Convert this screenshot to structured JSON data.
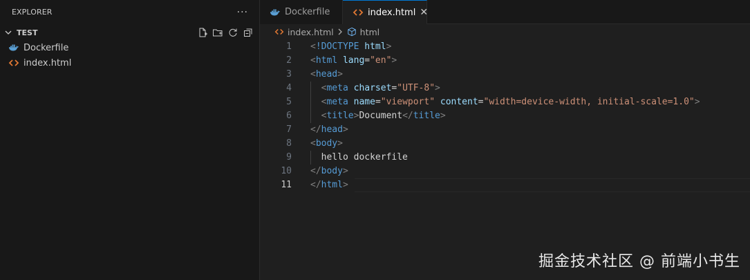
{
  "colors": {
    "accent": "#0078d4",
    "html_icon": "#e37933",
    "docker_icon": "#5a9fd4",
    "tag": "#569cd6",
    "attr": "#9cdcfe",
    "string": "#ce9178"
  },
  "sidebar": {
    "title": "EXPLORER",
    "more": "···",
    "folder": "TEST",
    "files": [
      {
        "name": "Dockerfile",
        "icon": "docker-icon"
      },
      {
        "name": "index.html",
        "icon": "html-file-icon"
      }
    ],
    "actions": [
      "new-file-icon",
      "new-folder-icon",
      "refresh-icon",
      "collapse-all-icon"
    ]
  },
  "tabs": [
    {
      "label": "Dockerfile",
      "active": false
    },
    {
      "label": "index.html",
      "active": true
    }
  ],
  "breadcrumb": {
    "file": "index.html",
    "element": "html"
  },
  "editor": {
    "current_line": 11,
    "lines": [
      {
        "num": "1",
        "tokens": [
          [
            "punc",
            "<"
          ],
          [
            "tag",
            "!DOCTYPE"
          ],
          [
            "punc",
            " "
          ],
          [
            "attr",
            "html"
          ],
          [
            "punc",
            ">"
          ]
        ]
      },
      {
        "num": "2",
        "tokens": [
          [
            "punc",
            "<"
          ],
          [
            "tag",
            "html"
          ],
          [
            "punc",
            " "
          ],
          [
            "attr",
            "lang"
          ],
          [
            "text",
            "="
          ],
          [
            "str",
            "\"en\""
          ],
          [
            "punc",
            ">"
          ]
        ]
      },
      {
        "num": "3",
        "tokens": [
          [
            "punc",
            "<"
          ],
          [
            "tag",
            "head"
          ],
          [
            "punc",
            ">"
          ]
        ]
      },
      {
        "num": "4",
        "tokens": [
          [
            "text",
            "  "
          ],
          [
            "punc",
            "<"
          ],
          [
            "tag",
            "meta"
          ],
          [
            "punc",
            " "
          ],
          [
            "attr",
            "charset"
          ],
          [
            "text",
            "="
          ],
          [
            "str",
            "\"UTF-8\""
          ],
          [
            "punc",
            ">"
          ]
        ]
      },
      {
        "num": "5",
        "tokens": [
          [
            "text",
            "  "
          ],
          [
            "punc",
            "<"
          ],
          [
            "tag",
            "meta"
          ],
          [
            "punc",
            " "
          ],
          [
            "attr",
            "name"
          ],
          [
            "text",
            "="
          ],
          [
            "str",
            "\"viewport\""
          ],
          [
            "punc",
            " "
          ],
          [
            "attr",
            "content"
          ],
          [
            "text",
            "="
          ],
          [
            "str",
            "\"width=device-width, initial-scale=1.0\""
          ],
          [
            "punc",
            ">"
          ]
        ]
      },
      {
        "num": "6",
        "tokens": [
          [
            "text",
            "  "
          ],
          [
            "punc",
            "<"
          ],
          [
            "tag",
            "title"
          ],
          [
            "punc",
            ">"
          ],
          [
            "text",
            "Document"
          ],
          [
            "punc",
            "</"
          ],
          [
            "tag",
            "title"
          ],
          [
            "punc",
            ">"
          ]
        ]
      },
      {
        "num": "7",
        "tokens": [
          [
            "punc",
            "</"
          ],
          [
            "tag",
            "head"
          ],
          [
            "punc",
            ">"
          ]
        ]
      },
      {
        "num": "8",
        "tokens": [
          [
            "punc",
            "<"
          ],
          [
            "tag",
            "body"
          ],
          [
            "punc",
            ">"
          ]
        ]
      },
      {
        "num": "9",
        "tokens": [
          [
            "text",
            "  hello dockerfile"
          ]
        ]
      },
      {
        "num": "10",
        "tokens": [
          [
            "punc",
            "</"
          ],
          [
            "tag",
            "body"
          ],
          [
            "punc",
            ">"
          ]
        ]
      },
      {
        "num": "11",
        "tokens": [
          [
            "punc",
            "</"
          ],
          [
            "tag",
            "html"
          ],
          [
            "punc",
            ">"
          ]
        ]
      }
    ]
  },
  "watermark": "掘金技术社区 @ 前端小书生"
}
